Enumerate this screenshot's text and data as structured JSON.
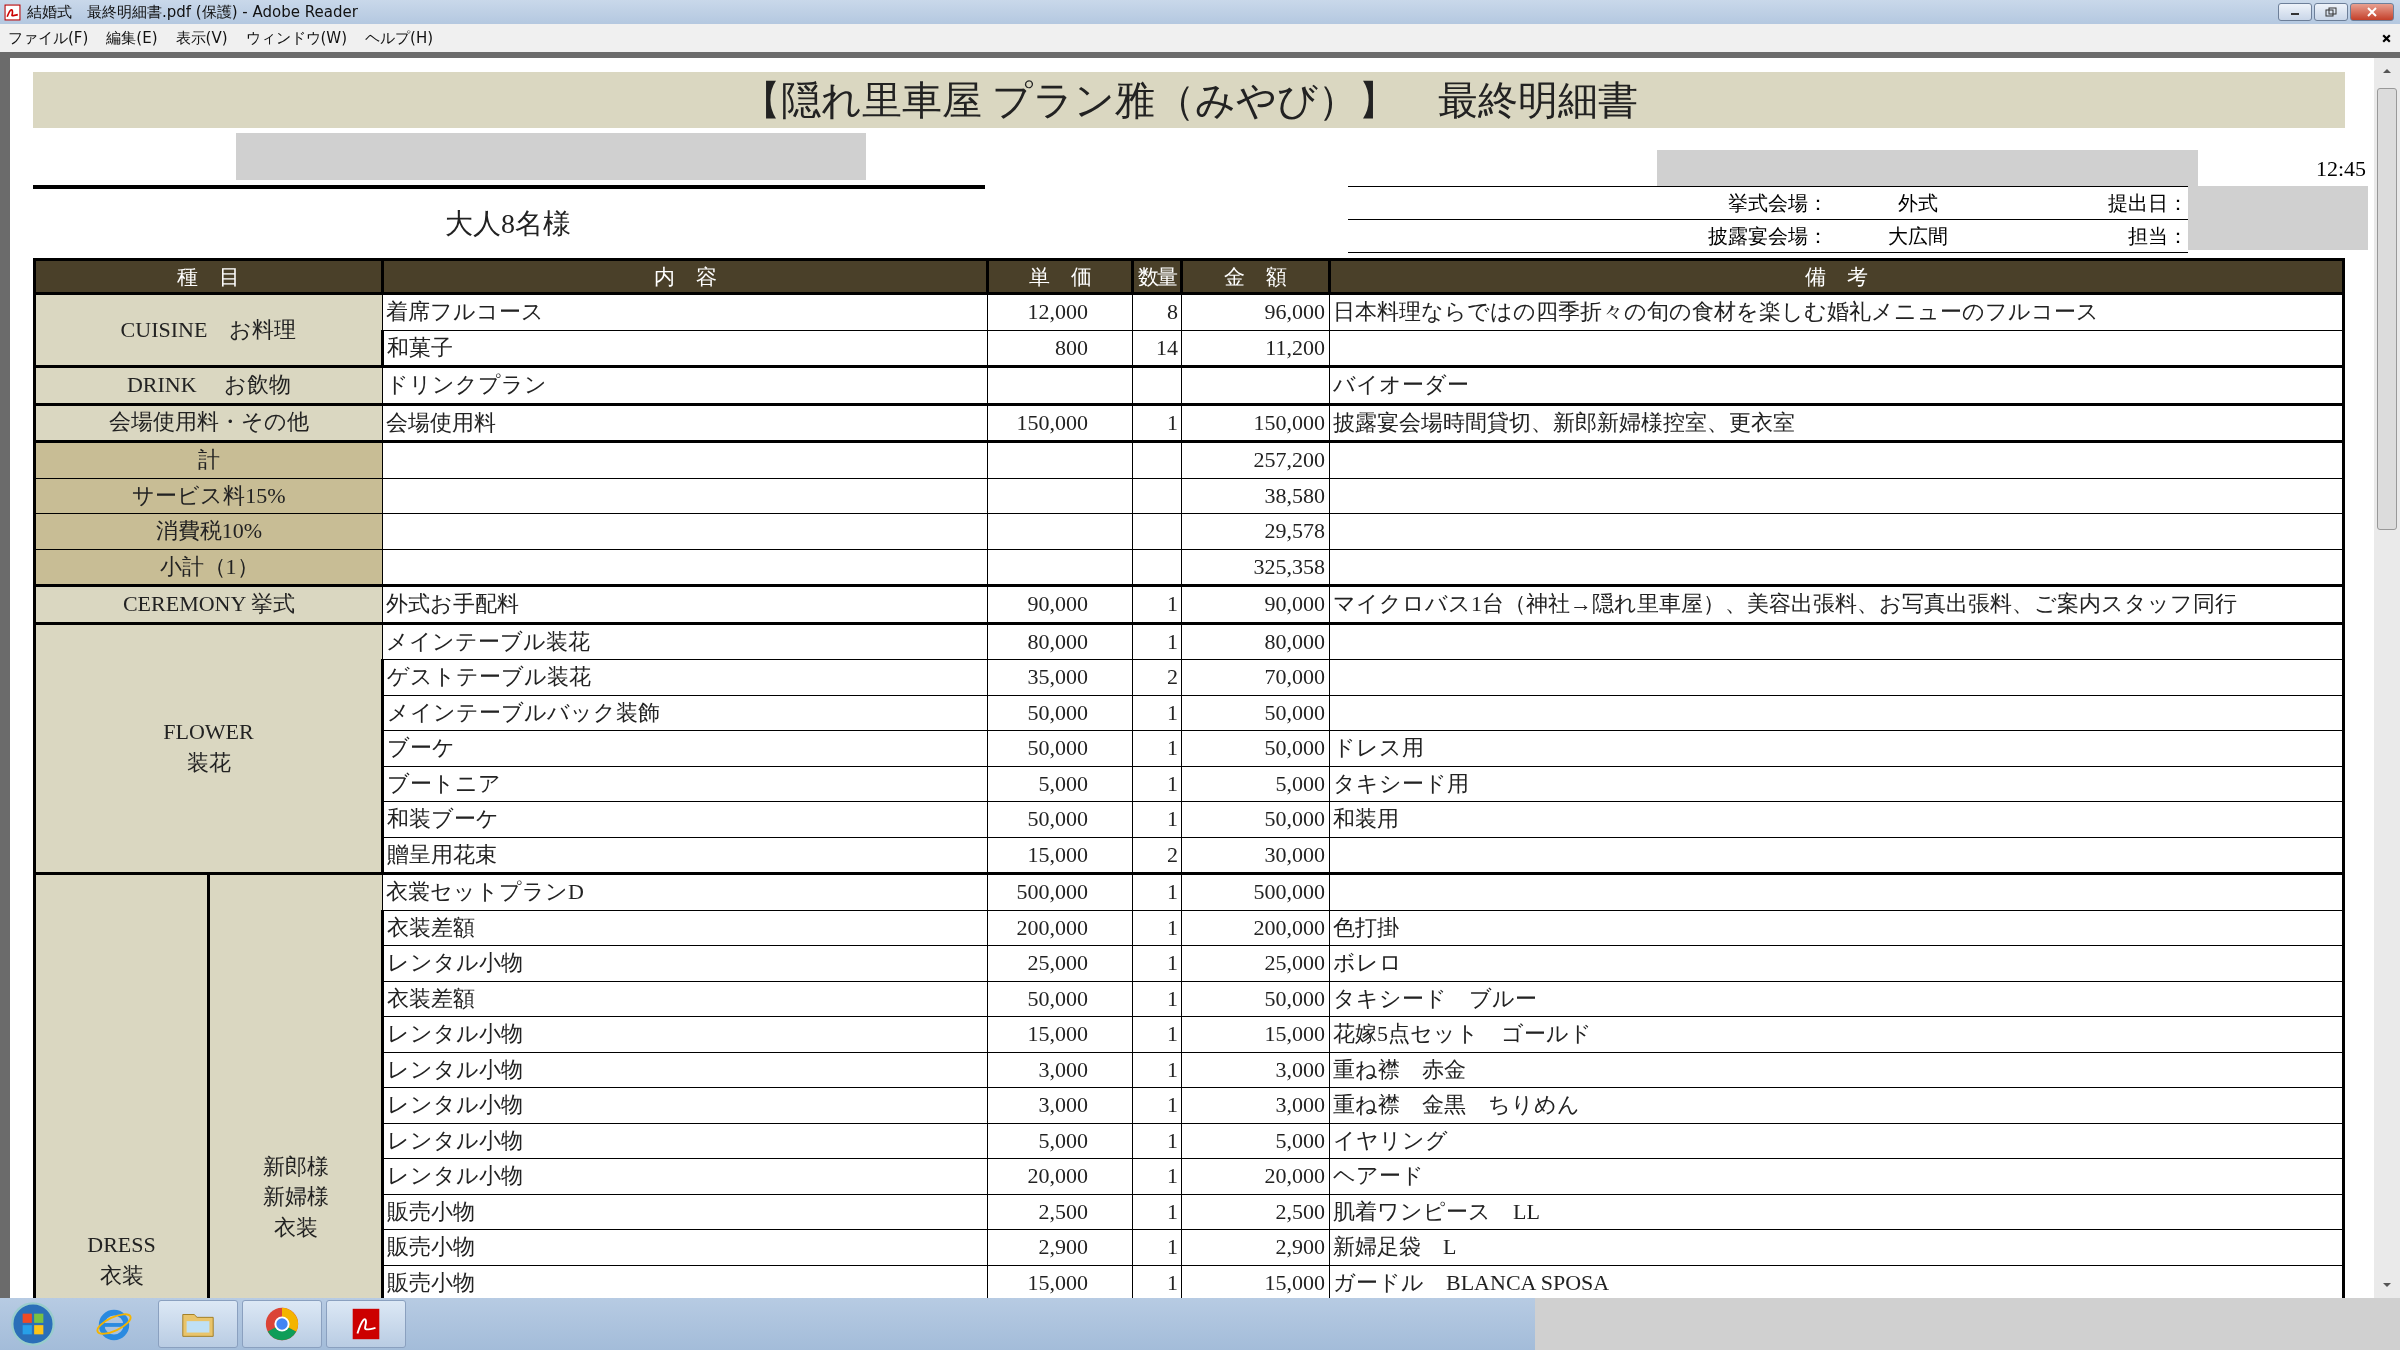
{
  "window": {
    "title": "結婚式　最終明細書.pdf (保護) - Adobe Reader"
  },
  "menu": [
    "ファイル(F)",
    "編集(E)",
    "表示(V)",
    "ウィンドウ(W)",
    "ヘルプ(H)"
  ],
  "document": {
    "title": "【隠れ里車屋 プラン雅（みやび）】　最終明細書",
    "guests": "大人8名様",
    "time": "12:45",
    "info": [
      {
        "label": "挙式会場：",
        "value": "外式",
        "field_label": "提出日："
      },
      {
        "label": "披露宴会場：",
        "value": "大広間",
        "field_label": "担当："
      }
    ]
  },
  "table": {
    "columns": [
      "種　目",
      "内　容",
      "単　価",
      "数量",
      "金　額",
      "備　考"
    ],
    "sections": [
      {
        "kind": "single",
        "label": [
          "CUISINE　お料理"
        ],
        "rows": [
          {
            "item": "着席フルコース",
            "unit_price": "12,000",
            "qty": "8",
            "amount": "96,000",
            "note": "日本料理ならではの四季折々の旬の食材を楽しむ婚礼メニューのフルコース"
          },
          {
            "item": "和菓子",
            "unit_price": "800",
            "qty": "14",
            "amount": "11,200",
            "note": ""
          }
        ]
      },
      {
        "kind": "single",
        "label": [
          "DRINK　 お飲物"
        ],
        "rows": [
          {
            "item": "ドリンクプラン",
            "unit_price": "",
            "qty": "",
            "amount": "",
            "note": "バイオーダー"
          }
        ]
      },
      {
        "kind": "single",
        "label": [
          "会場使用料・その他"
        ],
        "rows": [
          {
            "item": "会場使用料",
            "unit_price": "150,000",
            "qty": "1",
            "amount": "150,000",
            "note": "披露宴会場時間貸切、新郎新婦様控室、更衣室"
          }
        ]
      },
      {
        "kind": "summary",
        "rows": [
          {
            "label": "計",
            "amount": "257,200"
          },
          {
            "label": "サービス料15%",
            "amount": "38,580"
          },
          {
            "label": "消費税10%",
            "amount": "29,578"
          },
          {
            "label": "小計（1）",
            "amount": "325,358"
          }
        ]
      },
      {
        "kind": "single",
        "label": [
          "CEREMONY 挙式"
        ],
        "rows": [
          {
            "item": "外式お手配料",
            "unit_price": "90,000",
            "qty": "1",
            "amount": "90,000",
            "note": "マイクロバス1台（神社→隠れ里車屋）、美容出張料、お写真出張料、ご案内スタッフ同行"
          }
        ]
      },
      {
        "kind": "single",
        "label": [
          "FLOWER",
          "装花"
        ],
        "rows": [
          {
            "item": "メインテーブル装花",
            "unit_price": "80,000",
            "qty": "1",
            "amount": "80,000",
            "note": ""
          },
          {
            "item": "ゲストテーブル装花",
            "unit_price": "35,000",
            "qty": "2",
            "amount": "70,000",
            "note": ""
          },
          {
            "item": "メインテーブルバック装飾",
            "unit_price": "50,000",
            "qty": "1",
            "amount": "50,000",
            "note": ""
          },
          {
            "item": "ブーケ",
            "unit_price": "50,000",
            "qty": "1",
            "amount": "50,000",
            "note": "ドレス用"
          },
          {
            "item": "ブートニア",
            "unit_price": "5,000",
            "qty": "1",
            "amount": "5,000",
            "note": "タキシード用"
          },
          {
            "item": "和装ブーケ",
            "unit_price": "50,000",
            "qty": "1",
            "amount": "50,000",
            "note": "和装用"
          },
          {
            "item": "贈呈用花束",
            "unit_price": "15,000",
            "qty": "2",
            "amount": "30,000",
            "note": ""
          }
        ]
      },
      {
        "kind": "split",
        "label": [
          "DRESS",
          "衣装"
        ],
        "sub_label": [
          "新郎様",
          "新婦様",
          "衣装"
        ],
        "rows": [
          {
            "item": "衣裳セットプランD",
            "unit_price": "500,000",
            "qty": "1",
            "amount": "500,000",
            "note": ""
          },
          {
            "item": "衣装差額",
            "unit_price": "200,000",
            "qty": "1",
            "amount": "200,000",
            "note": "色打掛"
          },
          {
            "item": "レンタル小物",
            "unit_price": "25,000",
            "qty": "1",
            "amount": "25,000",
            "note": "ボレロ"
          },
          {
            "item": "衣装差額",
            "unit_price": "50,000",
            "qty": "1",
            "amount": "50,000",
            "note": "タキシード　ブルー"
          },
          {
            "item": "レンタル小物",
            "unit_price": "15,000",
            "qty": "1",
            "amount": "15,000",
            "note": "花嫁5点セット　ゴールド"
          },
          {
            "item": "レンタル小物",
            "unit_price": "3,000",
            "qty": "1",
            "amount": "3,000",
            "note": "重ね襟　赤金"
          },
          {
            "item": "レンタル小物",
            "unit_price": "3,000",
            "qty": "1",
            "amount": "3,000",
            "note": "重ね襟　金黒　ちりめん"
          },
          {
            "item": "レンタル小物",
            "unit_price": "5,000",
            "qty": "1",
            "amount": "5,000",
            "note": "イヤリング"
          },
          {
            "item": "レンタル小物",
            "unit_price": "20,000",
            "qty": "1",
            "amount": "20,000",
            "note": "ヘアード"
          },
          {
            "item": "販売小物",
            "unit_price": "2,500",
            "qty": "1",
            "amount": "2,500",
            "note": "肌着ワンピース　LL"
          },
          {
            "item": "販売小物",
            "unit_price": "2,900",
            "qty": "1",
            "amount": "2,900",
            "note": "新婦足袋　L"
          },
          {
            "item": "販売小物",
            "unit_price": "15,000",
            "qty": "1",
            "amount": "15,000",
            "note": "ガードル　BLANCA SPOSA"
          }
        ]
      }
    ]
  }
}
